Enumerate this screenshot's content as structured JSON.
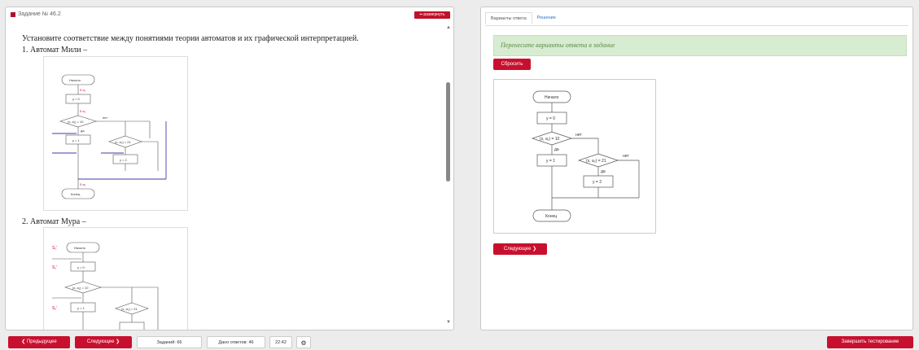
{
  "left": {
    "task_title": "Задание № 46.2",
    "expand_label": "▪▪ развернуть",
    "question": "Установите соответствие между понятиями теории автоматов и их графической интерпретацией.",
    "item1": "1. Автомат Мили –",
    "item2": "2. Автомат Мура –"
  },
  "flowchart": {
    "start": "Начало",
    "end": "Конец",
    "assign0": "y = 0",
    "assign1": "y = 1",
    "assign2": "y = 2",
    "cond1": "(x, a₁) = 10",
    "cond2": "(x, a₂) = 21",
    "yes": "да",
    "no": "нет"
  },
  "right": {
    "tab_variants": "Варианты ответа",
    "tab_solution": "Решение",
    "hint": "Перенесите варианты ответа в задание",
    "reset_label": "Сбросить",
    "next_label": "Следующее ❯"
  },
  "footer": {
    "prev": "❮ Предыдущее",
    "next": "Следующее ❯",
    "tasks": "Заданий: 66",
    "answers": "Дано ответов: 46",
    "time": "22:42",
    "settings_icon": "⚙",
    "finish": "Завершить тестирование"
  },
  "colors": {
    "accent": "#c8102e",
    "hint_bg": "#d7ecd0",
    "link": "#2a72c4"
  }
}
